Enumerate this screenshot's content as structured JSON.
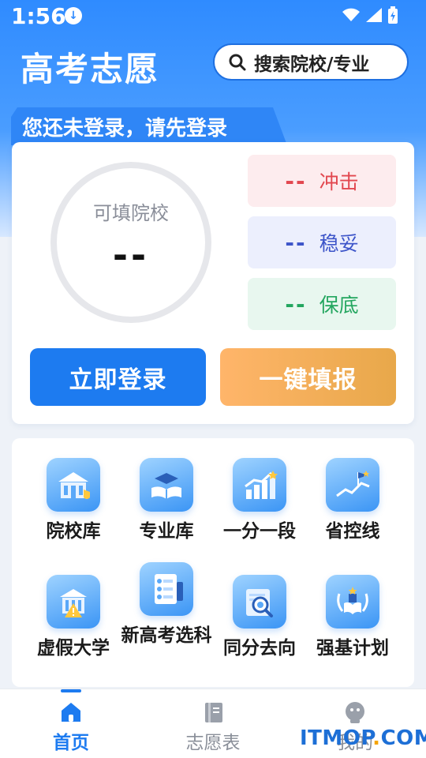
{
  "status_bar": {
    "time": "1:56"
  },
  "header": {
    "title": "高考志愿",
    "search_label": "搜索院校/专业"
  },
  "login_banner": {
    "text": "您还未登录，请先登录"
  },
  "summary": {
    "ring_label": "可填院校",
    "ring_value": "--",
    "stats": [
      {
        "value": "--",
        "label": "冲击",
        "color": "#e2474f"
      },
      {
        "value": "--",
        "label": "稳妥",
        "color": "#3d55c9"
      },
      {
        "value": "--",
        "label": "保底",
        "color": "#23a65f"
      }
    ]
  },
  "actions": {
    "login": "立即登录",
    "quick_fill": "一键填报"
  },
  "tools": [
    {
      "label": "院校库",
      "icon": "school-building-icon"
    },
    {
      "label": "专业库",
      "icon": "graduation-book-icon"
    },
    {
      "label": "一分一段",
      "icon": "bar-chart-icon"
    },
    {
      "label": "省控线",
      "icon": "flag-trend-icon"
    },
    {
      "label": "虚假大学",
      "icon": "warning-building-icon"
    },
    {
      "label": "新高考选科",
      "icon": "checklist-icon"
    },
    {
      "label": "同分去向",
      "icon": "search-document-icon"
    },
    {
      "label": "强基计划",
      "icon": "laurel-book-icon"
    }
  ],
  "bottom_nav": [
    {
      "label": "首页",
      "icon": "home-icon",
      "active": true
    },
    {
      "label": "志愿表",
      "icon": "book-icon",
      "active": false
    },
    {
      "label": "我的",
      "icon": "user-icon",
      "active": false
    }
  ],
  "watermark": {
    "brand": "ITMOP",
    "dot": ".",
    "suffix": "COM"
  },
  "colors": {
    "primary": "#1d7bf0",
    "accent_orange": "#e8a84a"
  }
}
